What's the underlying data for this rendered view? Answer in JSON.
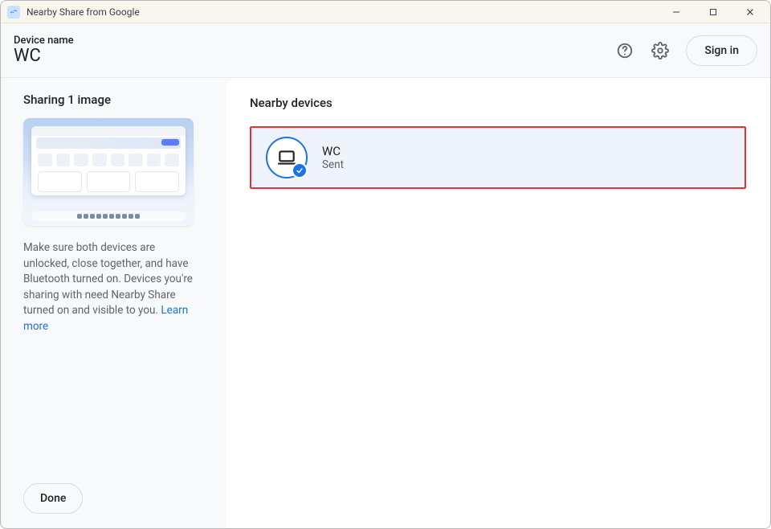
{
  "window": {
    "title": "Nearby Share from Google"
  },
  "header": {
    "device_label": "Device name",
    "device_value": "WC",
    "signin_label": "Sign in"
  },
  "sidebar": {
    "sharing_title": "Sharing 1 image",
    "help_text": "Make sure both devices are unlocked, close together, and have Bluetooth turned on. Devices you're sharing with need Nearby Share turned on and visible to you. ",
    "learn_more": "Learn more",
    "done_label": "Done"
  },
  "main": {
    "section_title": "Nearby devices",
    "devices": [
      {
        "name": "WC",
        "status": "Sent",
        "highlighted": true
      }
    ]
  },
  "colors": {
    "accent": "#1a73e8",
    "highlight_border": "#e93030"
  }
}
